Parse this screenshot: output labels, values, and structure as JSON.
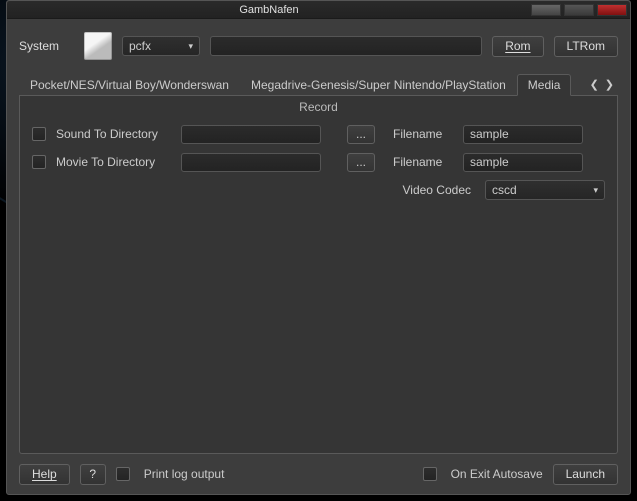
{
  "title": "GambNafen",
  "system": {
    "label": "System",
    "selected": "pcfx",
    "rom_button": "Rom",
    "ltrom_button": "LTRom"
  },
  "tabs": {
    "tab1": "Pocket/NES/Virtual Boy/Wonderswan",
    "tab2": "Megadrive-Genesis/Super Nintendo/PlayStation",
    "tab3": "Media"
  },
  "record": {
    "title": "Record",
    "sound_label": "Sound To Directory",
    "movie_label": "Movie To Directory",
    "browse": "...",
    "filename_label": "Filename",
    "sound_dir": "",
    "movie_dir": "",
    "sound_filename": "sample",
    "movie_filename": "sample",
    "codec_label": "Video Codec",
    "codec_value": "cscd"
  },
  "footer": {
    "help": "Help",
    "q": "?",
    "print_log": "Print log output",
    "autosave": "On Exit Autosave",
    "launch": "Launch"
  }
}
